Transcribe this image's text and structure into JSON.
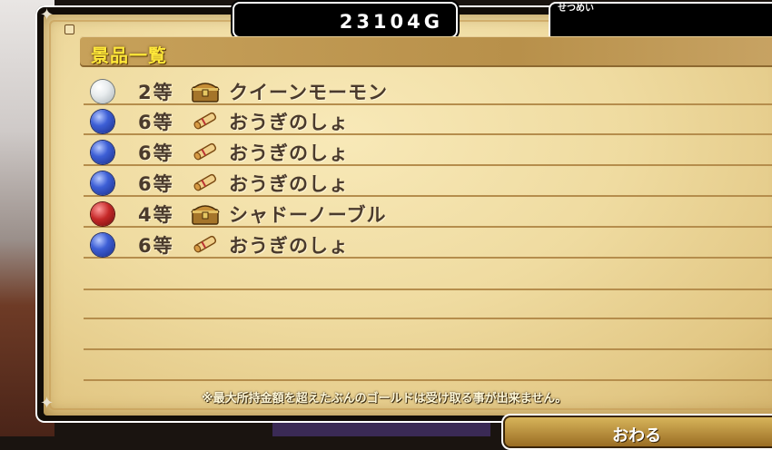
{
  "gold": {
    "value": "23104G"
  },
  "explanation": {
    "label": "せつめい"
  },
  "list": {
    "title": "景品一覧",
    "rows": [
      {
        "rank": "2等",
        "name": "クイーンモーモン",
        "orb": "white",
        "icon": "treasure-chest-icon"
      },
      {
        "rank": "6等",
        "name": "おうぎのしょ",
        "orb": "blue",
        "icon": "scroll-icon"
      },
      {
        "rank": "6等",
        "name": "おうぎのしょ",
        "orb": "blue",
        "icon": "scroll-icon"
      },
      {
        "rank": "6等",
        "name": "おうぎのしょ",
        "orb": "blue",
        "icon": "scroll-icon"
      },
      {
        "rank": "4等",
        "name": "シャドーノーブル",
        "orb": "red",
        "icon": "treasure-chest-icon"
      },
      {
        "rank": "6等",
        "name": "おうぎのしょ",
        "orb": "blue",
        "icon": "scroll-icon"
      }
    ]
  },
  "note": "※最大所持金額を超えたぶんのゴールドは受け取る事が出来ません。",
  "end_button": {
    "label": "おわる"
  },
  "colors": {
    "title_yellow": "#ffe83a",
    "text_brown": "#4a3a2c",
    "parchment": "#efdba0",
    "header_band": "#b8904a"
  }
}
